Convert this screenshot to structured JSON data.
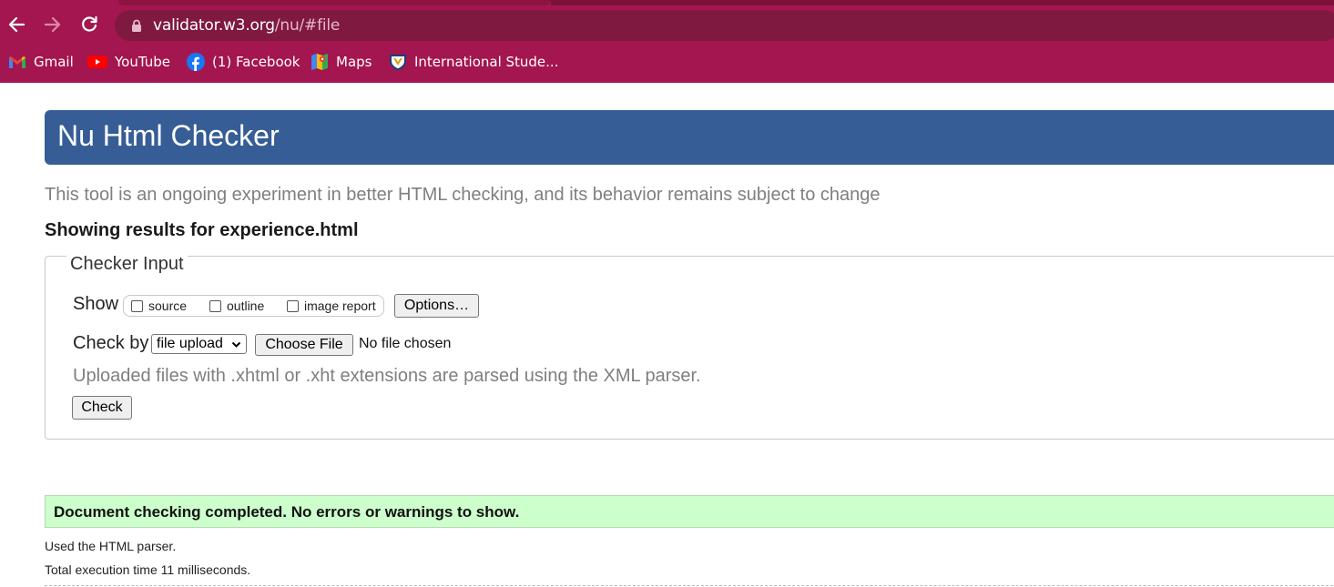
{
  "browser": {
    "url_host": "validator.w3.org",
    "url_path": "/nu/#file",
    "bookmarks": [
      {
        "label": "Gmail",
        "icon": "gmail-icon"
      },
      {
        "label": "YouTube",
        "icon": "youtube-icon"
      },
      {
        "label": "(1) Facebook",
        "icon": "facebook-icon"
      },
      {
        "label": "Maps",
        "icon": "maps-icon"
      },
      {
        "label": "International Stude...",
        "icon": "shield-crest-icon"
      }
    ],
    "colors": {
      "chrome": "#a4164f",
      "omnibox": "#7f1940"
    }
  },
  "page": {
    "title": "Nu Html Checker",
    "tagline": "This tool is an ongoing experiment in better HTML checking, and its behavior remains subject to change",
    "showing": "Showing results for experience.html",
    "checker": {
      "legend": "Checker Input",
      "show_label": "Show",
      "options": [
        {
          "label": "source",
          "checked": false
        },
        {
          "label": "outline",
          "checked": false
        },
        {
          "label": "image report",
          "checked": false
        }
      ],
      "options_button": "Options…",
      "check_by_label": "Check by",
      "check_by_value": "file upload",
      "choose_file_button": "Choose File",
      "no_file": "No file chosen",
      "note": "Uploaded files with .xhtml or .xht extensions are parsed using the XML parser.",
      "check_button": "Check"
    },
    "result": {
      "message": "Document checking completed. No errors or warnings to show.",
      "parser": "Used the HTML parser.",
      "execution": "Total execution time 11 milliseconds."
    },
    "colors": {
      "banner": "#365d95",
      "success": "#ccffcc"
    }
  }
}
